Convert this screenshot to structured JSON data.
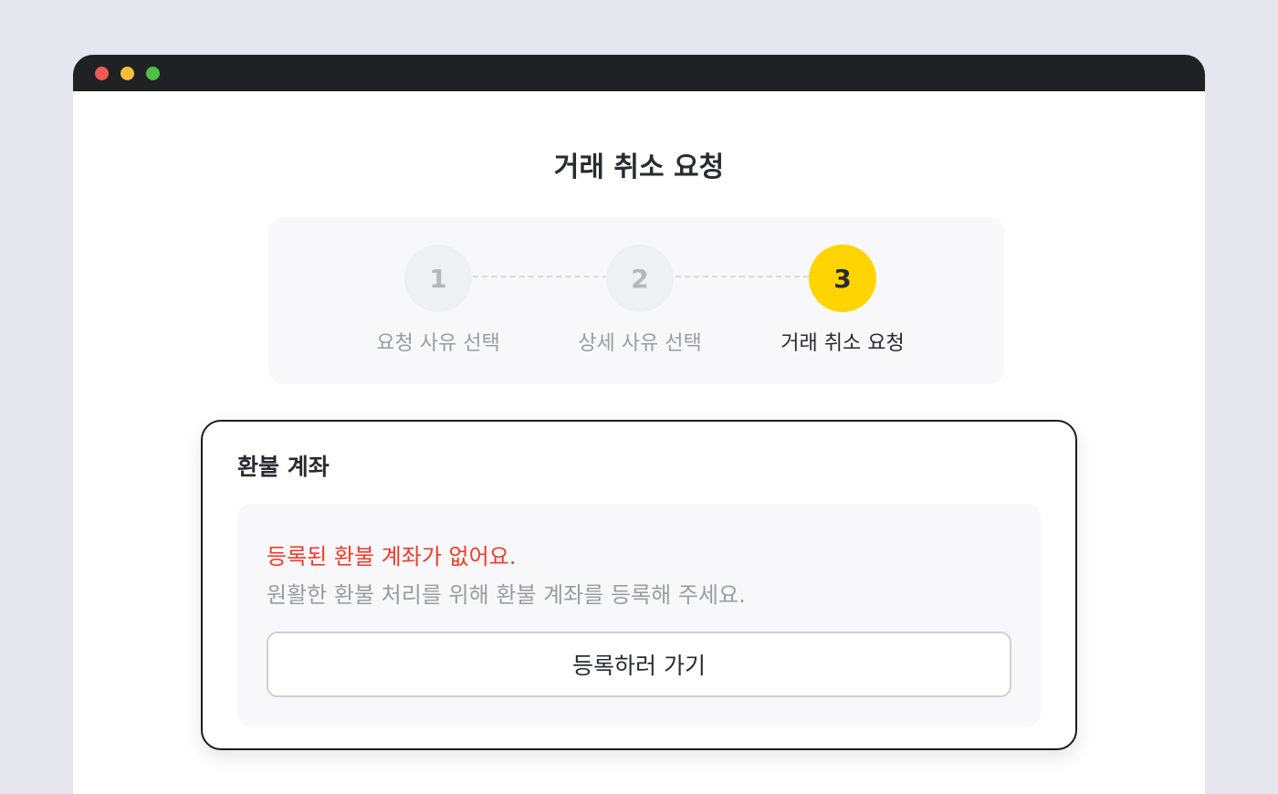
{
  "window": {
    "controls": [
      {
        "name": "close-dot",
        "color": "#ef5a57"
      },
      {
        "name": "minimize-dot",
        "color": "#f6bd3a"
      },
      {
        "name": "maximize-dot",
        "color": "#4cc144"
      }
    ]
  },
  "page": {
    "title": "거래 취소 요청"
  },
  "stepper": {
    "current_step": 3,
    "steps": [
      {
        "number": "1",
        "label": "요청 사유 선택"
      },
      {
        "number": "2",
        "label": "상세 사유 선택"
      },
      {
        "number": "3",
        "label": "거래 취소 요청"
      }
    ],
    "active_color": "#ffd400"
  },
  "refund_account": {
    "title": "환불 계좌",
    "error_message": "등록된 환불 계좌가 없어요.",
    "help_message": "원활한 환불 처리를 위해 환불 계좌를 등록해 주세요.",
    "register_button_label": "등록하러 가기",
    "error_color": "#ef3b2d"
  }
}
